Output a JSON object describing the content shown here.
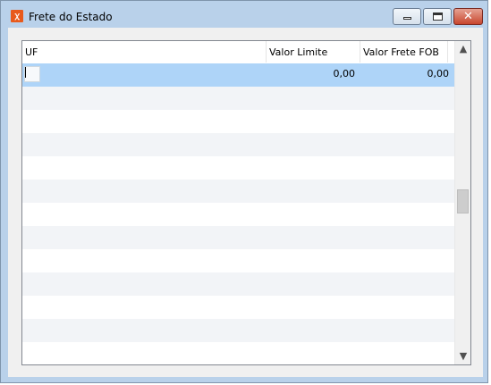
{
  "window": {
    "title": "Frete do Estado",
    "app_icon_glyph": "ꭓ",
    "app_icon": "app-logo-icon",
    "buttons": {
      "minimize": "minimize-icon",
      "maximize": "maximize-icon",
      "close_glyph": "✕"
    }
  },
  "grid": {
    "columns": [
      "UF",
      "Valor Limite",
      "Valor Frete FOB"
    ],
    "rows": [
      {
        "uf": "",
        "valor_limite": "0,00",
        "valor_frete_fob": "0,00"
      }
    ],
    "empty_rows": 12
  },
  "scrollbar": {
    "up": "▲",
    "down": "▼"
  },
  "colors": {
    "selected_row": "#aed4f8",
    "alt_row": "#f2f4f7",
    "frame": "#b9d1ea",
    "close_button": "#c8462e"
  }
}
